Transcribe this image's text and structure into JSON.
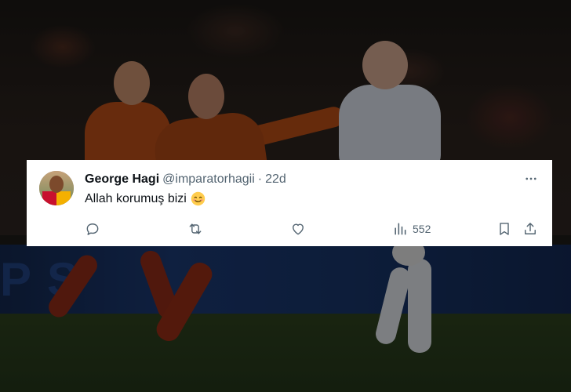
{
  "tweet": {
    "display_name": "George Hagi",
    "handle": "@imparatorhagii",
    "separator": "·",
    "time": "22d",
    "text": "Allah korumuş bizi",
    "emoji": "smiling-face-emoji",
    "views_count": "552"
  },
  "background": {
    "board_text": "PS"
  },
  "icons": {
    "reply": "reply-icon",
    "retweet": "retweet-icon",
    "like": "heart-icon",
    "views": "views-chart-icon",
    "bookmark": "bookmark-icon",
    "share": "share-icon",
    "more": "more-dots-icon"
  },
  "colors": {
    "card_background": "#ffffff",
    "primary_text": "#0f1419",
    "secondary_text": "#536471"
  }
}
